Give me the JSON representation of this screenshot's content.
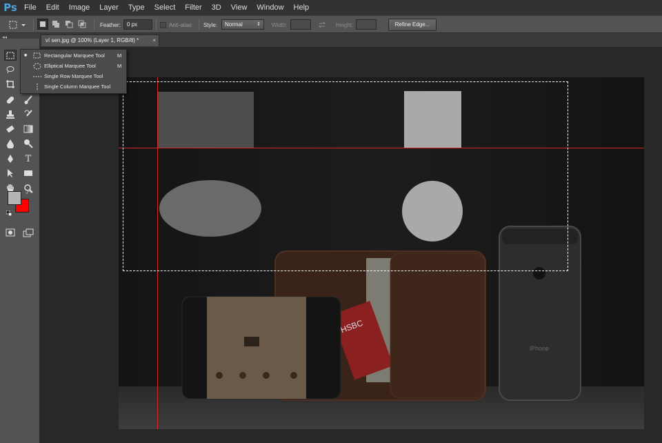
{
  "app": {
    "logo": "Ps"
  },
  "menu": [
    "File",
    "Edit",
    "Image",
    "Layer",
    "Type",
    "Select",
    "Filter",
    "3D",
    "View",
    "Window",
    "Help"
  ],
  "options": {
    "feather_label": "Feather:",
    "feather_value": "0 px",
    "antialias_label": "Anti-alias",
    "style_label": "Style:",
    "style_value": "Normal",
    "width_label": "Width:",
    "height_label": "Height:",
    "refine_label": "Refine Edge..."
  },
  "document": {
    "tab_title": "ví sen.jpg @ 100% (Layer 1, RGB/8) *",
    "close": "×"
  },
  "flyout": {
    "items": [
      {
        "label": "Rectangular Marquee Tool",
        "key": "M"
      },
      {
        "label": "Elliptical Marquee Tool",
        "key": "M"
      },
      {
        "label": "Single Row Marquee Tool",
        "key": ""
      },
      {
        "label": "Single Column Marquee Tool",
        "key": ""
      }
    ]
  },
  "colors": {
    "foreground": "#b4b4b4",
    "background": "#ff0000",
    "guide": "#d8262a",
    "accent": "#4aa3df"
  },
  "image_text": {
    "card_brand": "HSBC",
    "phone_label": "iPhone"
  }
}
